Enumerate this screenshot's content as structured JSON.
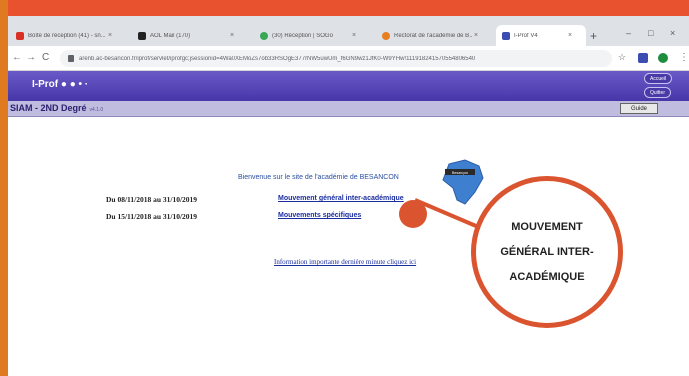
{
  "browser": {
    "tabs": [
      {
        "label": "Boîte de réception (41) - sn...",
        "icon_color": "#d93025"
      },
      {
        "label": "AOL Mail (170)",
        "icon_color": "#222222"
      },
      {
        "label": "(30) Réception | SOGo",
        "icon_color": "#3aa757"
      },
      {
        "label": "Rectorat de l'académie de B...",
        "icon_color": "#e67e22"
      },
      {
        "label": "I-Prof V4",
        "icon_color": "#3b4db0",
        "active": true
      }
    ],
    "url": "arenb.ac-besancon.fr/iprof/servlet/iprofgc;jsessionid=4Wa0XEMoZs7ob33RSOgE377rNW5uwUm_f6GN9wz1JfK0-W9YHw!1119182415705548065­40",
    "new_tab": "+",
    "window_controls": [
      "–",
      "□",
      "×"
    ],
    "nav": {
      "back": "←",
      "forward": "→",
      "reload": "C"
    },
    "star": "☆"
  },
  "iprof": {
    "brand": "I-Prof ● ● • ·",
    "top_buttons": [
      "Accueil",
      "Quitter"
    ],
    "subtitle": "SIAM - 2ND Degré",
    "version": "v4.1.0",
    "guide_label": "Guide"
  },
  "content": {
    "welcome": "Bienvenue sur le site de l'académie de BESANCON",
    "logo_caption": "Besançon",
    "rows": [
      {
        "dates": "Du 08/11/2018 au 31/10/2019",
        "link": "Mouvement général inter-académique"
      },
      {
        "dates": "Du 15/11/2018 au 31/10/2019",
        "link": "Mouvements spécifiques"
      }
    ],
    "info_link": "Information importante dernière minute cliquez ici"
  },
  "callout": {
    "lines": [
      "MOUVEMENT",
      "GÉNÉRAL INTER-",
      "ACADÉMIQUE"
    ],
    "color": "#d9542f"
  }
}
